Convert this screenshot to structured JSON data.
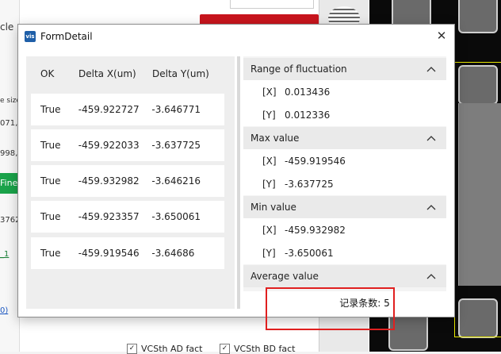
{
  "background": {
    "fragments": [
      "cle",
      "e size",
      "071,",
      "998,",
      "Fine",
      "3762",
      "_1",
      "0)"
    ],
    "checkboxes": [
      {
        "label": "VCSth AD fact",
        "checked": true
      },
      {
        "label": "VCSth BD fact",
        "checked": true
      }
    ]
  },
  "dialog": {
    "icon_text": "vis",
    "title": "FormDetail",
    "close_glyph": "✕",
    "grid": {
      "headers": [
        "OK",
        "Delta X(um)",
        "Delta Y(um)"
      ],
      "rows": [
        {
          "ok": "True",
          "dx": "-459.922727",
          "dy": "-3.646771"
        },
        {
          "ok": "True",
          "dx": "-459.922033",
          "dy": "-3.637725"
        },
        {
          "ok": "True",
          "dx": "-459.932982",
          "dy": "-3.646216"
        },
        {
          "ok": "True",
          "dx": "-459.923357",
          "dy": "-3.650061"
        },
        {
          "ok": "True",
          "dx": "-459.919546",
          "dy": "-3.64686"
        }
      ]
    },
    "sections": {
      "range": {
        "title": "Range of fluctuation",
        "x_label": "[X]",
        "x": "0.013436",
        "y_label": "[Y]",
        "y": "0.012336"
      },
      "max": {
        "title": "Max value",
        "x_label": "[X]",
        "x": "-459.919546",
        "y_label": "[Y]",
        "y": "-3.637725"
      },
      "min": {
        "title": "Min value",
        "x_label": "[X]",
        "x": "-459.932982",
        "y_label": "[Y]",
        "y": "-3.650061"
      },
      "avg": {
        "title": "Average value"
      }
    },
    "status": "记录条数: 5"
  },
  "colors": {
    "highlight": "#e02020",
    "accent": "#1aa34a",
    "brand_red": "#c8151d"
  }
}
